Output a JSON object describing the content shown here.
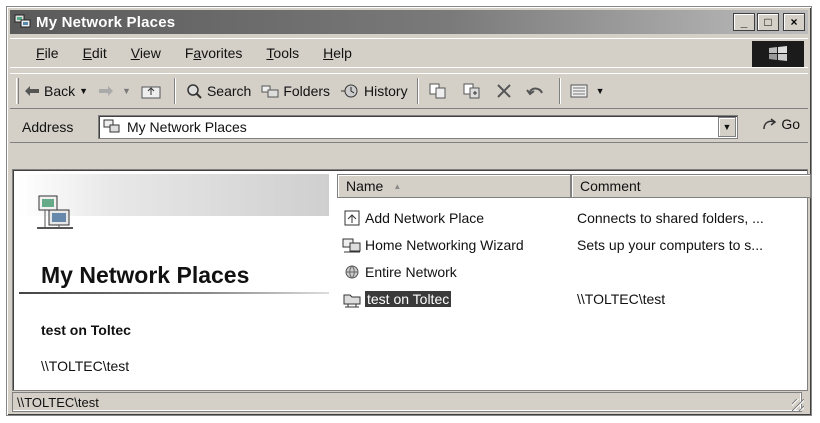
{
  "window": {
    "title": "My Network Places",
    "controls": {
      "minimize": "_",
      "maximize": "□",
      "close": "×"
    }
  },
  "menubar": {
    "items": [
      {
        "label": "File",
        "key": "F"
      },
      {
        "label": "Edit",
        "key": "E"
      },
      {
        "label": "View",
        "key": "V"
      },
      {
        "label": "Favorites",
        "key": "a"
      },
      {
        "label": "Tools",
        "key": "T"
      },
      {
        "label": "Help",
        "key": "H"
      }
    ]
  },
  "toolbar": {
    "back_label": "Back",
    "search_label": "Search",
    "folders_label": "Folders",
    "history_label": "History"
  },
  "address": {
    "label": "Address",
    "value": "My Network Places",
    "go_label": "Go"
  },
  "left_pane": {
    "title": "My Network Places",
    "selected_name": "test on Toltec",
    "selected_path": "\\\\TOLTEC\\test"
  },
  "list": {
    "columns": {
      "name": "Name",
      "comment": "Comment"
    },
    "rows": [
      {
        "name": "Add Network Place",
        "comment": "Connects to shared folders, ...",
        "icon": "add-network-place-icon"
      },
      {
        "name": "Home Networking Wizard",
        "comment": "Sets up your computers to s...",
        "icon": "wizard-icon"
      },
      {
        "name": "Entire Network",
        "comment": "",
        "icon": "entire-network-icon"
      },
      {
        "name": "test on Toltec",
        "comment": "\\\\TOLTEC\\test",
        "icon": "network-share-icon"
      }
    ]
  },
  "status": {
    "text": "\\\\TOLTEC\\test"
  },
  "colors": {
    "title_bar": "#6a6a6a",
    "chrome": "#d4d0c8",
    "selection": "#3a3a3a"
  }
}
